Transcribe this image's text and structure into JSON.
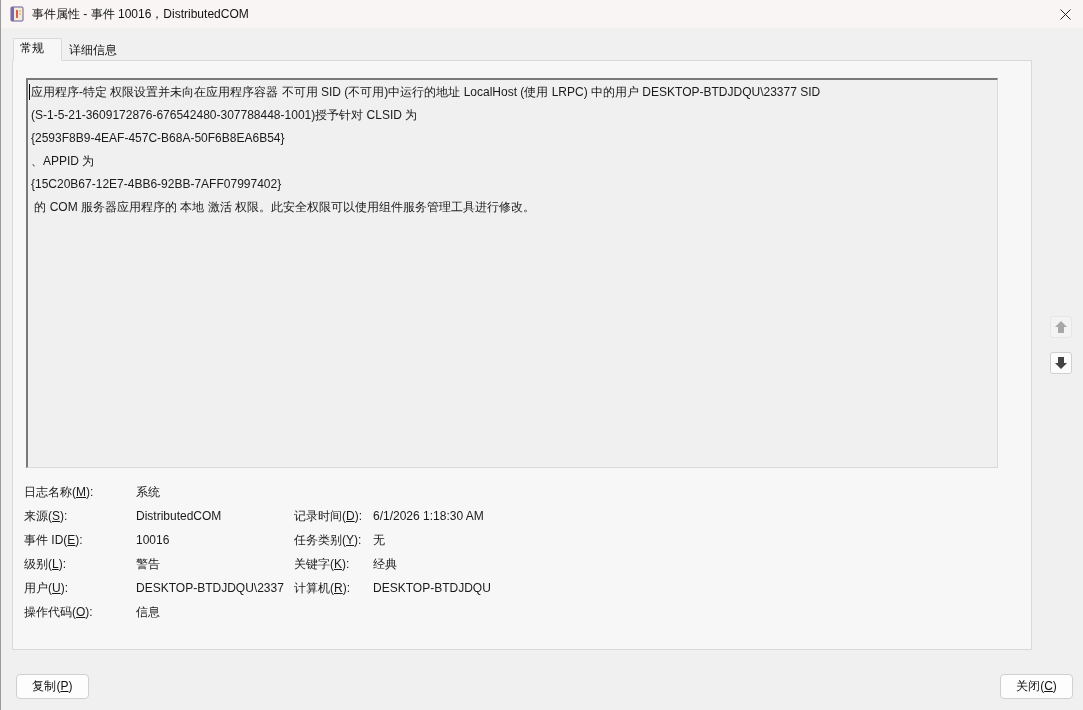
{
  "window": {
    "title": "事件属性 - 事件 10016，DistributedCOM"
  },
  "tabs": [
    {
      "label": "常规",
      "selected": true
    },
    {
      "label": "详细信息",
      "selected": false
    }
  ],
  "description": {
    "lines": [
      "应用程序-特定 权限设置并未向在应用程序容器 不可用 SID (不可用)中运行的地址 LocalHost (使用 LRPC) 中的用户 DESKTOP-BTDJDQU\\23377 SID",
      "(S-1-5-21-3609172876-676542480-307788448-1001)授予针对 CLSID 为",
      "{2593F8B9-4EAF-457C-B68A-50F6B8EA6B54}",
      "、APPID 为",
      "{15C20B67-12E7-4BB6-92BB-7AFF07997402}",
      " 的 COM 服务器应用程序的 本地 激活 权限。此安全权限可以使用组件服务管理工具进行修改。"
    ]
  },
  "scroll_buttons": [
    {
      "kind": "up",
      "disabled": true
    },
    {
      "kind": "down",
      "disabled": false
    }
  ],
  "fields": [
    {
      "left": {
        "label": {
          "before": "日志名称(",
          "key": "M",
          "after": "):"
        },
        "value": "系统"
      }
    },
    {
      "left": {
        "label": {
          "before": "来源(",
          "key": "S",
          "after": "):"
        },
        "value": "DistributedCOM"
      },
      "right": {
        "label": {
          "before": "记录时间(",
          "key": "D",
          "after": "):"
        },
        "value": "6/1/2026 1:18:30 AM"
      }
    },
    {
      "left": {
        "label": {
          "before": "事件 ID(",
          "key": "E",
          "after": "):"
        },
        "value": "10016"
      },
      "right": {
        "label": {
          "before": "任务类别(",
          "key": "Y",
          "after": "):"
        },
        "value": "无"
      }
    },
    {
      "left": {
        "label": {
          "before": "级别(",
          "key": "L",
          "after": "):"
        },
        "value": "警告"
      },
      "right": {
        "label": {
          "before": "关键字(",
          "key": "K",
          "after": "):"
        },
        "value": "经典"
      }
    },
    {
      "left": {
        "label": {
          "before": "用户(",
          "key": "U",
          "after": "):"
        },
        "value": "DESKTOP-BTDJDQU\\2337"
      },
      "right": {
        "label": {
          "before": "计算机(",
          "key": "R",
          "after": "):"
        },
        "value": "DESKTOP-BTDJDQU"
      }
    },
    {
      "left": {
        "label": {
          "before": "操作代码(",
          "key": "O",
          "after": "):"
        },
        "value": "信息"
      }
    }
  ],
  "buttons": [
    {
      "label": {
        "before": "复制(",
        "key": "P",
        "after": ")"
      }
    },
    {
      "label": {
        "before": "关闭(",
        "key": "C",
        "after": ")"
      }
    }
  ]
}
